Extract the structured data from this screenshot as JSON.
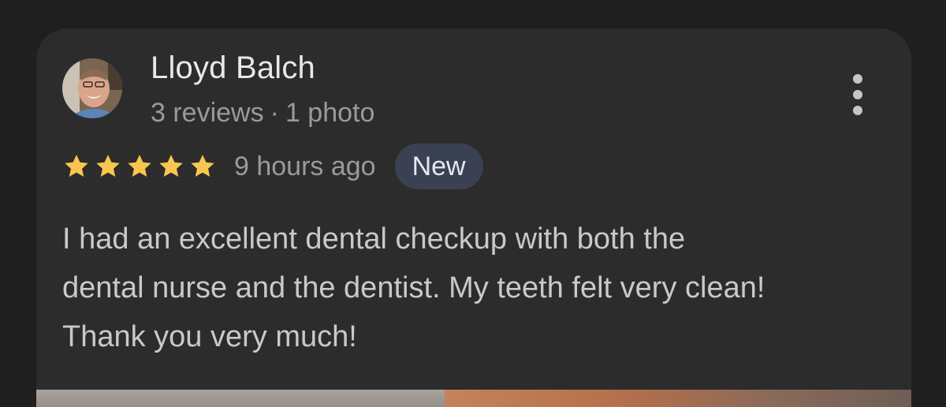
{
  "review": {
    "reviewer_name": "Lloyd Balch",
    "reviews_count": "3 reviews",
    "meta_separator": "·",
    "photos_count": "1 photo",
    "rating": 5,
    "rating_max": 5,
    "time_ago": "9 hours ago",
    "badge": "New",
    "text_lines": [
      "I had an excellent dental checkup with both the",
      "dental nurse and the dentist. My teeth felt very clean!",
      "Thank you very much!"
    ]
  },
  "icons": {
    "more": "more-vertical-icon",
    "star": "star-icon"
  },
  "colors": {
    "background": "#1f1f1f",
    "card": "#2c2c2c",
    "star": "#f9c74f",
    "badge_bg": "#3a4153",
    "name_text": "#e8e8e8",
    "secondary_text": "#9a9a9a"
  }
}
